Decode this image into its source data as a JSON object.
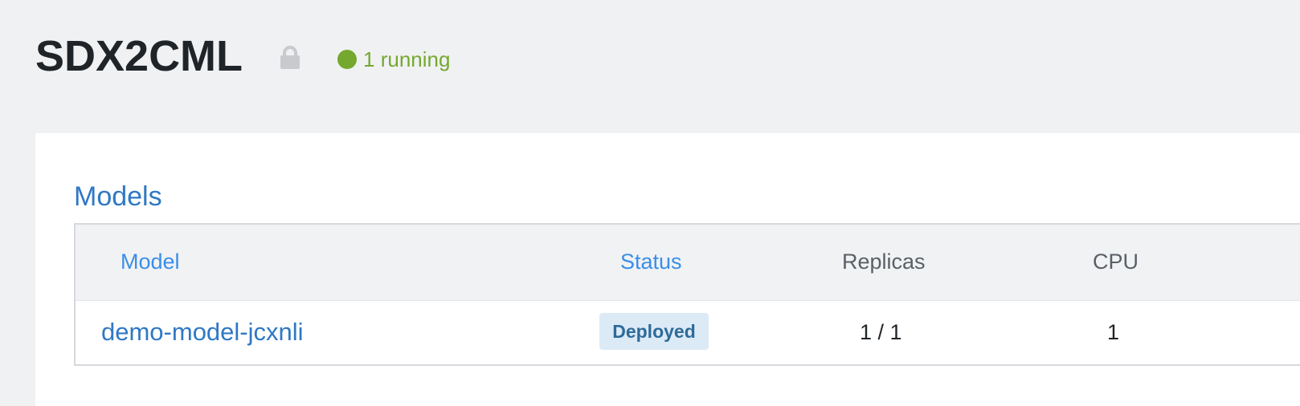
{
  "project": {
    "title": "SDX2CML",
    "lock_icon": "lock-icon",
    "running_status": "1 running",
    "running_color": "#75a82e"
  },
  "models_section": {
    "title": "Models",
    "columns": {
      "model": "Model",
      "status": "Status",
      "replicas": "Replicas",
      "cpu": "CPU"
    },
    "rows": [
      {
        "model": "demo-model-jcxnli",
        "status": "Deployed",
        "replicas": "1 / 1",
        "cpu": "1"
      }
    ]
  },
  "colors": {
    "link": "#2f78c4",
    "sortable_header": "#3a8ee8",
    "badge_bg": "#dceaf6",
    "badge_text": "#2d6a9a"
  }
}
